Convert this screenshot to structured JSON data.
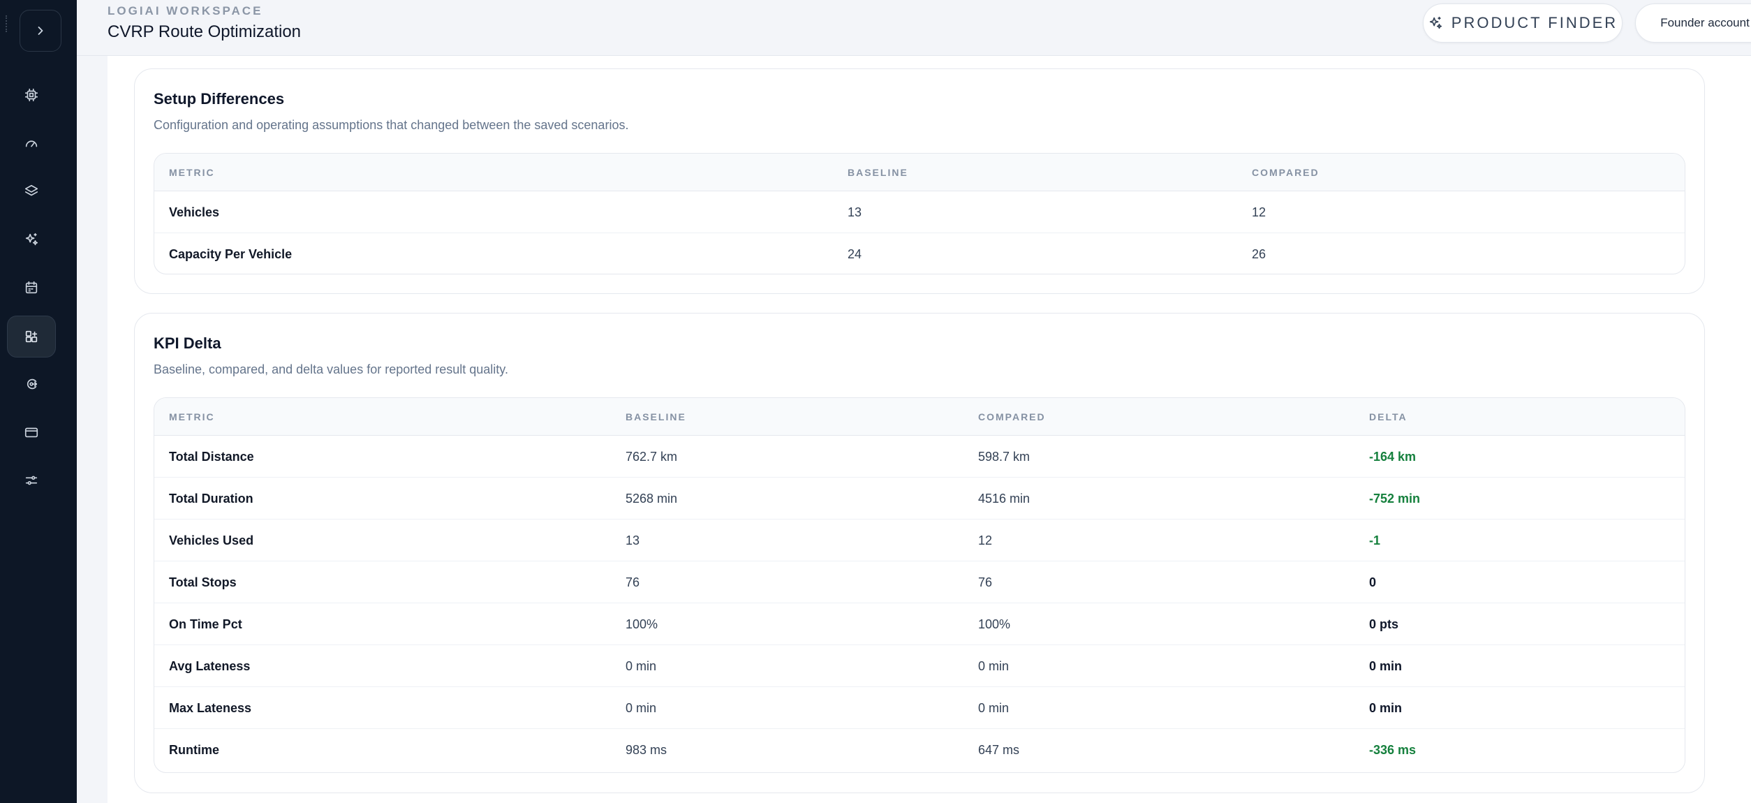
{
  "header": {
    "eyebrow": "LOGIAI WORKSPACE",
    "title": "CVRP Route Optimization",
    "product_finder_label": "PRODUCT FINDER",
    "account_label": "Founder account"
  },
  "sidebar": {
    "items": [
      {
        "icon": "cpu-icon",
        "active": false
      },
      {
        "icon": "gauge-icon",
        "active": false
      },
      {
        "icon": "layers-icon",
        "active": false
      },
      {
        "icon": "sparkle-icon",
        "active": false
      },
      {
        "icon": "calendar-icon",
        "active": false
      },
      {
        "icon": "compare-icon",
        "active": true
      },
      {
        "icon": "code-branch-icon",
        "active": false
      },
      {
        "icon": "card-icon",
        "active": false
      },
      {
        "icon": "sliders-icon",
        "active": false
      }
    ]
  },
  "setup": {
    "title": "Setup Differences",
    "subtitle": "Configuration and operating assumptions that changed between the saved scenarios.",
    "columns": [
      "METRIC",
      "BASELINE",
      "COMPARED"
    ],
    "rows": [
      {
        "metric": "Vehicles",
        "baseline": "13",
        "compared": "12"
      },
      {
        "metric": "Capacity Per Vehicle",
        "baseline": "24",
        "compared": "26"
      }
    ]
  },
  "kpi": {
    "title": "KPI Delta",
    "subtitle": "Baseline, compared, and delta values for reported result quality.",
    "columns": [
      "METRIC",
      "BASELINE",
      "COMPARED",
      "DELTA"
    ],
    "rows": [
      {
        "metric": "Total Distance",
        "baseline": "762.7 km",
        "compared": "598.7 km",
        "delta": "-164 km",
        "improved": true
      },
      {
        "metric": "Total Duration",
        "baseline": "5268 min",
        "compared": "4516 min",
        "delta": "-752 min",
        "improved": true
      },
      {
        "metric": "Vehicles Used",
        "baseline": "13",
        "compared": "12",
        "delta": "-1",
        "improved": true
      },
      {
        "metric": "Total Stops",
        "baseline": "76",
        "compared": "76",
        "delta": "0",
        "improved": false
      },
      {
        "metric": "On Time Pct",
        "baseline": "100%",
        "compared": "100%",
        "delta": "0 pts",
        "improved": false
      },
      {
        "metric": "Avg Lateness",
        "baseline": "0 min",
        "compared": "0 min",
        "delta": "0 min",
        "improved": false
      },
      {
        "metric": "Max Lateness",
        "baseline": "0 min",
        "compared": "0 min",
        "delta": "0 min",
        "improved": false
      },
      {
        "metric": "Runtime",
        "baseline": "983 ms",
        "compared": "647 ms",
        "delta": "-336 ms",
        "improved": true
      }
    ]
  },
  "colors": {
    "sidebar_bg": "#0d1726",
    "positive_delta": "#15803d"
  }
}
